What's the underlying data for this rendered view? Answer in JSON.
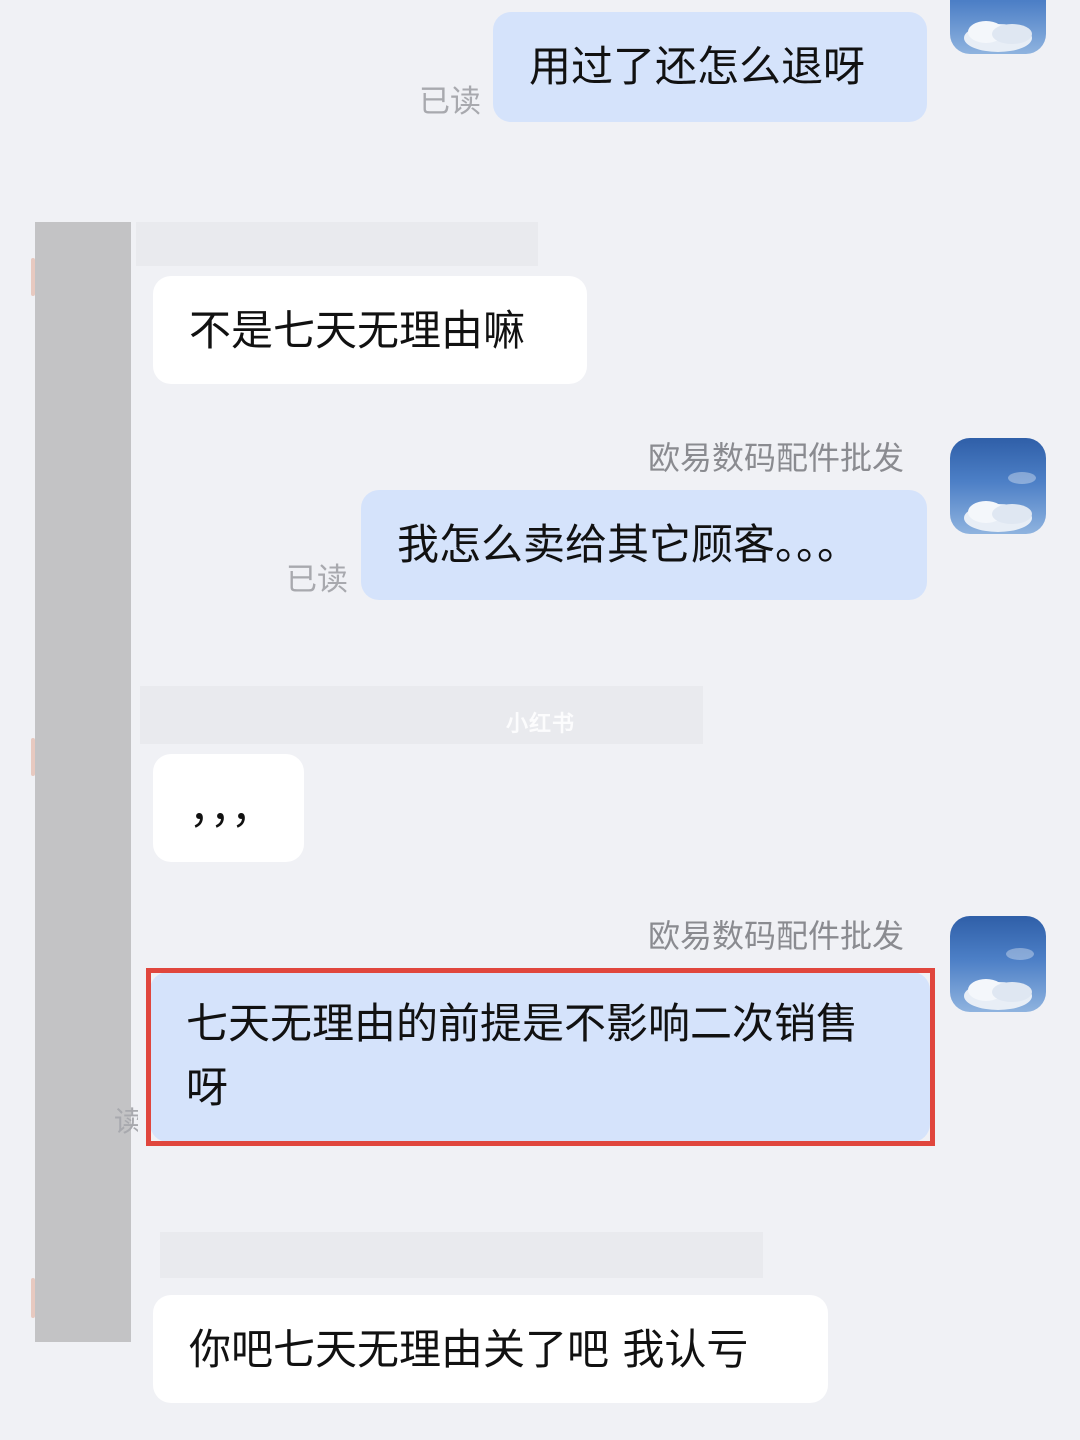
{
  "messages": [
    {
      "direction": "outgoing",
      "text": "用过了还怎么退呀",
      "status": "已读"
    },
    {
      "direction": "incoming",
      "text": "不是七天无理由嘛"
    },
    {
      "direction": "outgoing",
      "sender": "欧易数码配件批发",
      "text": "我怎么卖给其它顾客。。。",
      "status": "已读"
    },
    {
      "direction": "incoming",
      "text": "，，，"
    },
    {
      "direction": "outgoing",
      "sender": "欧易数码配件批发",
      "text": "七天无理由的前提是不影响二次销售呀",
      "highlighted": true
    },
    {
      "direction": "incoming",
      "text": "你吧七天无理由关了吧 我认亏"
    }
  ],
  "watermark": "小红书",
  "partial_read_fragment": "读",
  "colors": {
    "background": "#f0f1f5",
    "outgoing_bubble": "#d5e3fb",
    "incoming_bubble": "#ffffff",
    "highlight_border": "#e0463d",
    "redaction": "#c3c3c5"
  },
  "icons": {
    "avatar": "sky-clouds-avatar-icon"
  }
}
